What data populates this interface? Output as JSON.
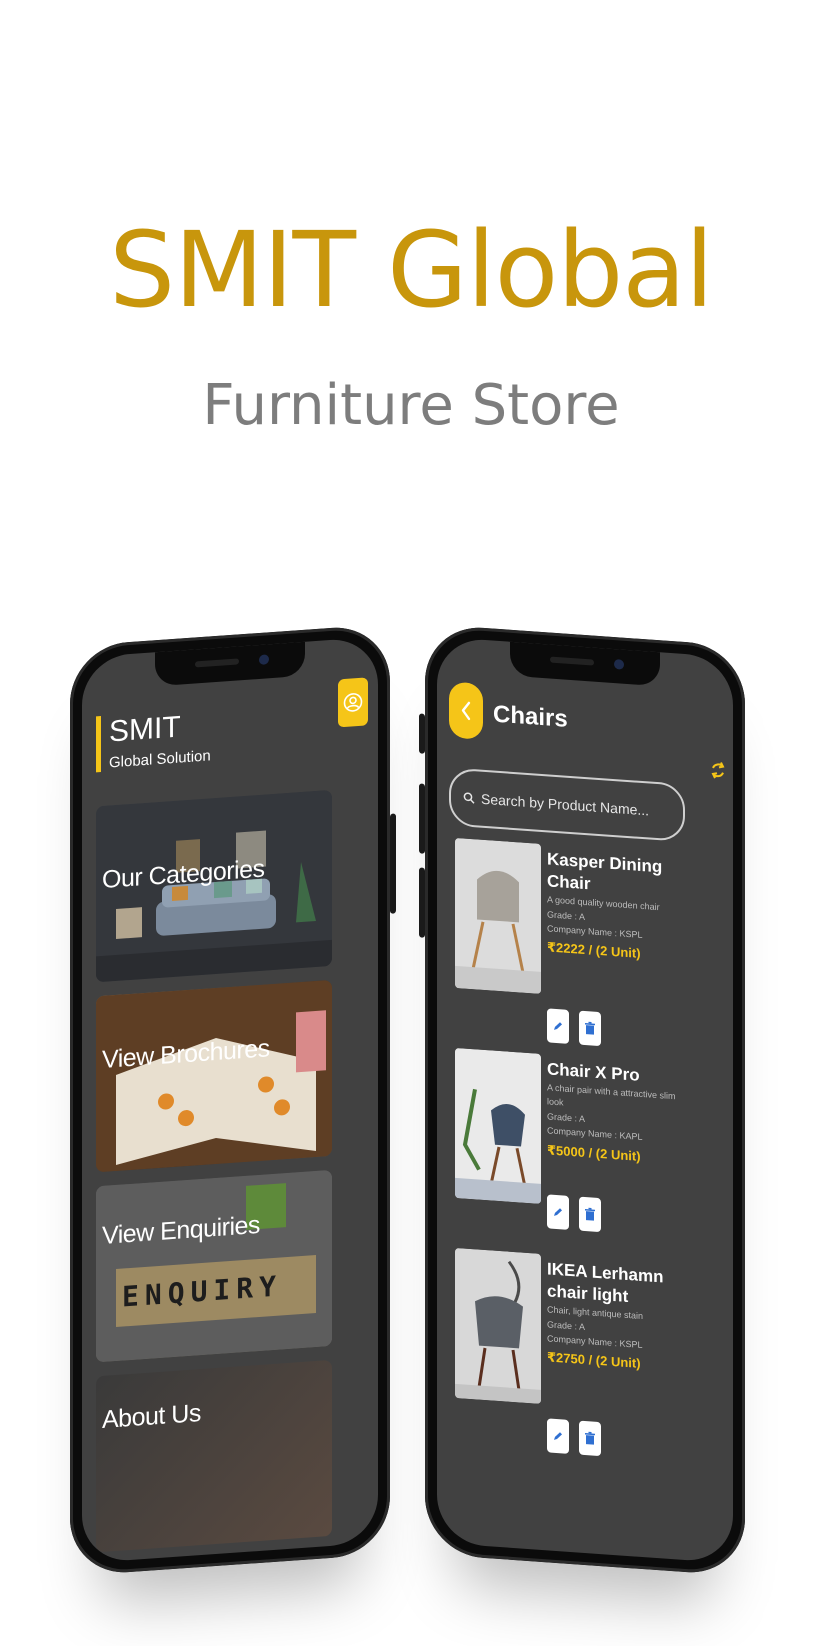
{
  "hero": {
    "title": "SMIT Global",
    "subtitle": "Furniture Store"
  },
  "left_screen": {
    "brand_name": "SMIT",
    "brand_tagline": "Global Solution",
    "menu": [
      {
        "label": "Our Categories"
      },
      {
        "label": "View Brochures"
      },
      {
        "label": "View Enquiries"
      },
      {
        "label": "About Us"
      }
    ],
    "enquiry_tiles": "ENQUIRY"
  },
  "right_screen": {
    "title": "Chairs",
    "search_placeholder": "Search by Product Name...",
    "products": [
      {
        "name": "Kasper Dining Chair",
        "description": "A good quality wooden chair",
        "grade": "Grade : A",
        "company": "Company Name : KSPL",
        "price": "₹2222 / (2 Unit)"
      },
      {
        "name": "Chair X Pro",
        "description": "A chair pair with a attractive slim look",
        "grade": "Grade : A",
        "company": "Company Name : KAPL",
        "price": "₹5000 / (2 Unit)"
      },
      {
        "name": "IKEA Lerhamn chair light",
        "description": "Chair, light antique stain",
        "grade": "Grade : A",
        "company": "Company Name : KSPL",
        "price": "₹2750 / (2 Unit)"
      }
    ]
  },
  "colors": {
    "brand_gold": "#c8960c",
    "accent_yellow": "#f5c518",
    "subtitle_gray": "#7d7d7d",
    "screen_bg": "#414141"
  }
}
